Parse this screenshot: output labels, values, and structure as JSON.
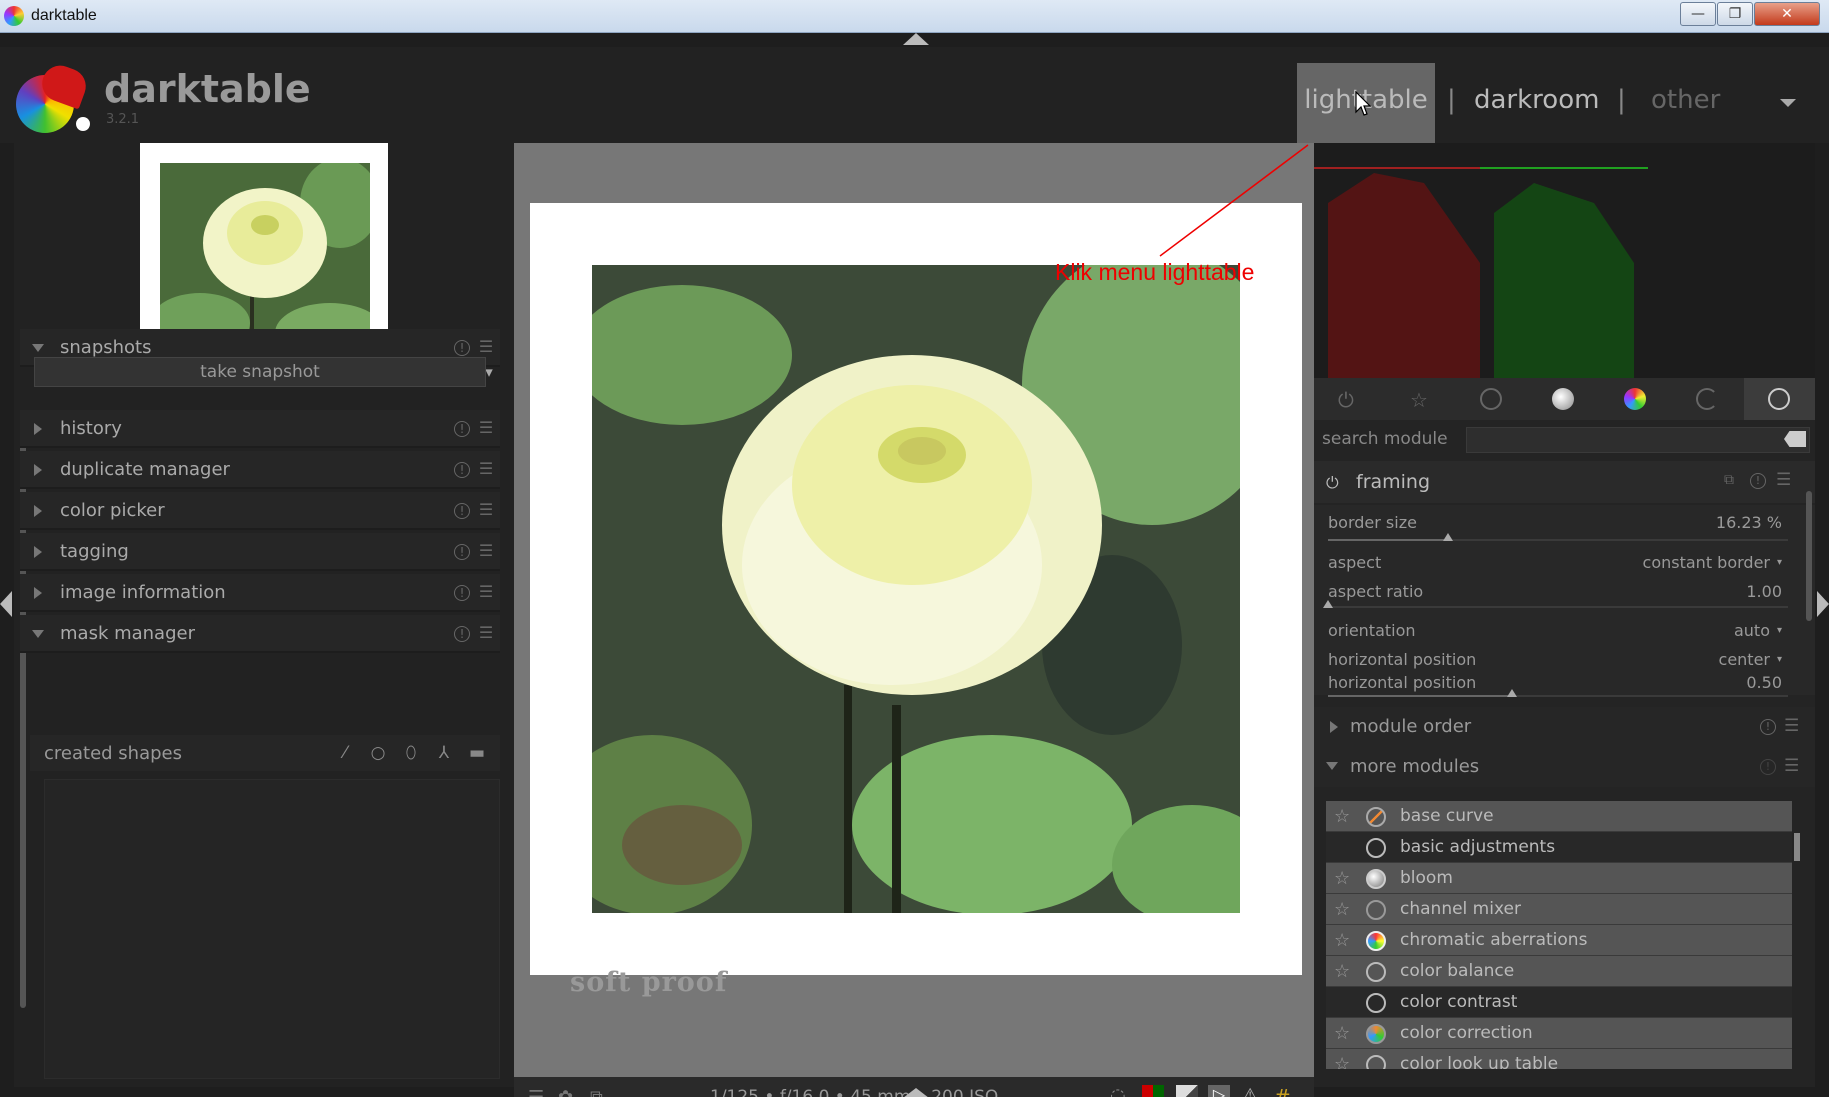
{
  "window": {
    "title": "darktable",
    "min": "—",
    "max": "❐",
    "close": "✕"
  },
  "app": {
    "name": "darktable",
    "version": "3.2.1"
  },
  "views": {
    "lighttable": "lighttable",
    "darkroom": "darkroom",
    "other": "other",
    "separator": "|"
  },
  "annotation": "Klik menu lighttable",
  "left_modules": [
    {
      "label": "snapshots",
      "expanded": true
    },
    {
      "label": "history",
      "expanded": false
    },
    {
      "label": "duplicate manager",
      "expanded": false
    },
    {
      "label": "color picker",
      "expanded": false
    },
    {
      "label": "tagging",
      "expanded": false
    },
    {
      "label": "image information",
      "expanded": false
    },
    {
      "label": "mask manager",
      "expanded": true
    }
  ],
  "snapshot_button": "take snapshot",
  "created_shapes": "created shapes",
  "soft_proof": "soft proof",
  "exif": "1/125 • f/16.0 • 45 mm • 200 ISO",
  "search_label": "search module",
  "framing": {
    "title": "framing",
    "params": [
      {
        "name": "border size",
        "value": "16.23 %",
        "level": 0.26
      },
      {
        "name": "aspect",
        "value": "constant border",
        "dropdown": true
      },
      {
        "name": "aspect ratio",
        "value": "1.00",
        "level": 0.0
      },
      {
        "name": "orientation",
        "value": "auto",
        "dropdown": true
      },
      {
        "name": "horizontal position",
        "value": "center",
        "dropdown": true
      },
      {
        "name": "horizontal position",
        "value": "0.50",
        "level": 0.4
      }
    ]
  },
  "module_order": "module order",
  "more_modules": "more modules",
  "more_modules_list": [
    {
      "label": "base curve",
      "fav": true
    },
    {
      "label": "basic adjustments",
      "fav": false
    },
    {
      "label": "bloom",
      "fav": true
    },
    {
      "label": "channel mixer",
      "fav": true
    },
    {
      "label": "chromatic aberrations",
      "fav": true
    },
    {
      "label": "color balance",
      "fav": true
    },
    {
      "label": "color contrast",
      "fav": false
    },
    {
      "label": "color correction",
      "fav": true
    },
    {
      "label": "color look up table",
      "fav": true
    }
  ],
  "colors": {
    "annotation": "#e00000",
    "active_tab": "#666666"
  },
  "icons": [
    "power-icon",
    "star-icon",
    "circle-icon",
    "tone-icon",
    "color-icon",
    "correct-icon",
    "effect-icon"
  ]
}
